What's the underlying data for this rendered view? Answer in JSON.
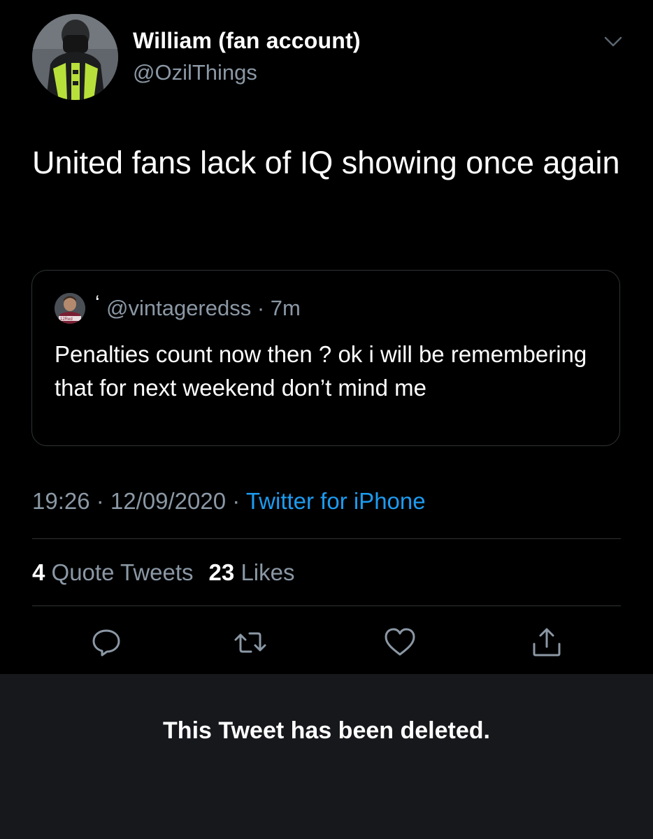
{
  "author": {
    "display_name": "William (fan account)",
    "handle": "@OzilThings"
  },
  "tweet": {
    "text": "United fans lack of IQ showing once again"
  },
  "quoted_tweet": {
    "name_mark": "‘",
    "handle_time": "@vintageredss · 7m",
    "text": "Penalties count now then ? ok i will be remembering that for next weekend don’t mind me",
    "avatar_caption": "12Red"
  },
  "meta": {
    "time": "19:26",
    "sep1": " · ",
    "date": "12/09/2020",
    "sep2": " · ",
    "source": "Twitter for iPhone"
  },
  "stats": {
    "quote_count": "4",
    "quote_label": "Quote Tweets",
    "like_count": "23",
    "like_label": "Likes"
  },
  "actions": {
    "icons": [
      "reply-icon",
      "retweet-icon",
      "like-icon",
      "share-icon"
    ]
  },
  "deleted_notice": "This Tweet has been deleted.",
  "colors": {
    "background": "#000000",
    "secondary_text": "#8b98a5",
    "link": "#1d9bf0",
    "divider": "#2f3336",
    "deleted_panel": "#16181c"
  }
}
